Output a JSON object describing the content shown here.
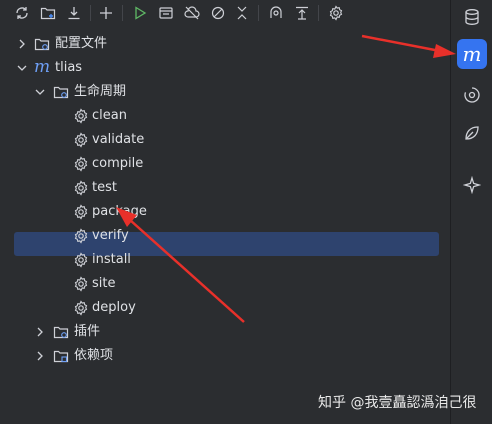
{
  "colors": {
    "background": "#2b2d30",
    "selection": "#2e436e",
    "active_tool": "#3574f0",
    "run_green": "#5fb865",
    "annotation_red": "#e8302a"
  },
  "toolbar": {
    "icons": [
      "refresh-icon",
      "folder-add-icon",
      "download-icon",
      "plus-icon",
      "run-icon",
      "run-configuration-icon",
      "offline-icon",
      "skip-tests-icon",
      "collapse-icon",
      "analyze-dependencies-icon",
      "show-diagram-icon",
      "settings-icon"
    ]
  },
  "tree": {
    "config_files": "配置文件",
    "project": "tlias",
    "lifecycle": "生命周期",
    "goals": [
      "clean",
      "validate",
      "compile",
      "test",
      "package",
      "verify",
      "install",
      "site",
      "deploy"
    ],
    "plugins": "插件",
    "dependencies": "依赖项"
  },
  "stripe": {
    "icons": [
      "database-icon",
      "maven-icon",
      "endpoints-icon",
      "leaf-icon",
      "ai-assistant-icon"
    ],
    "maven_glyph": "m"
  },
  "watermark": "知乎 @我壹矗認潙洎己很"
}
